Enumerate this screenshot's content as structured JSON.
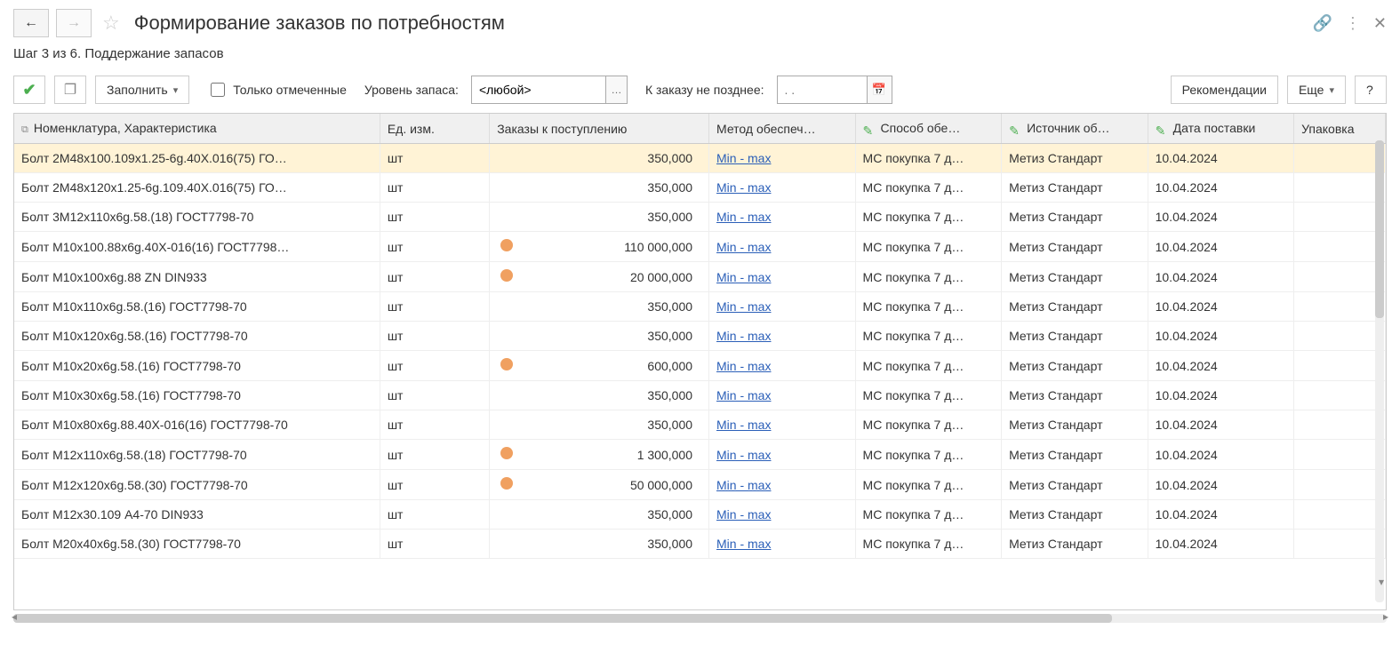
{
  "title": "Формирование заказов по потребностям",
  "breadcrumb": "Шаг 3 из 6. Поддержание запасов",
  "toolbar": {
    "fill_label": "Заполнить",
    "only_checked_label": "Только отмеченные",
    "stock_level_label": "Уровень запаса:",
    "stock_level_value": "<любой>",
    "order_before_label": "К заказу не позднее:",
    "date_placeholder": ". .",
    "recommendations_label": "Рекомендации",
    "more_label": "Еще",
    "help_label": "?"
  },
  "columns": {
    "name": "Номенклатура, Характеристика",
    "unit": "Ед. изм.",
    "orders": "Заказы к поступлению",
    "method": "Метод обеспеч",
    "way": "Способ обе",
    "source": "Источник об",
    "date": "Дата поставки",
    "pack": "Упаковка"
  },
  "method_link_text": "Min - max",
  "rows": [
    {
      "name": "Болт 2М48х100.109х1.25-6g.40Х.016(75) ГО…",
      "unit": "шт",
      "dot": false,
      "orders": "350,000",
      "way": "МС покупка 7 д…",
      "source": "Метиз Стандарт",
      "date": "10.04.2024",
      "selected": true
    },
    {
      "name": "Болт 2М48х120х1.25-6g.109.40Х.016(75) ГО…",
      "unit": "шт",
      "dot": false,
      "orders": "350,000",
      "way": "МС покупка 7 д…",
      "source": "Метиз Стандарт",
      "date": "10.04.2024"
    },
    {
      "name": "Болт 3М12х110х6g.58.(18) ГОСТ7798-70",
      "unit": "шт",
      "dot": false,
      "orders": "350,000",
      "way": "МС покупка 7 д…",
      "source": "Метиз Стандарт",
      "date": "10.04.2024"
    },
    {
      "name": "Болт М10х100.88х6g.40Х-016(16) ГОСТ7798…",
      "unit": "шт",
      "dot": true,
      "orders": "110 000,000",
      "way": "МС покупка 7 д…",
      "source": "Метиз Стандарт",
      "date": "10.04.2024"
    },
    {
      "name": "Болт М10х100х6g.88 ZN DIN933",
      "unit": "шт",
      "dot": true,
      "orders": "20 000,000",
      "way": "МС покупка 7 д…",
      "source": "Метиз Стандарт",
      "date": "10.04.2024"
    },
    {
      "name": "Болт М10х110х6g.58.(16) ГОСТ7798-70",
      "unit": "шт",
      "dot": false,
      "orders": "350,000",
      "way": "МС покупка 7 д…",
      "source": "Метиз Стандарт",
      "date": "10.04.2024"
    },
    {
      "name": "Болт М10х120х6g.58.(16) ГОСТ7798-70",
      "unit": "шт",
      "dot": false,
      "orders": "350,000",
      "way": "МС покупка 7 д…",
      "source": "Метиз Стандарт",
      "date": "10.04.2024"
    },
    {
      "name": "Болт М10х20х6g.58.(16) ГОСТ7798-70",
      "unit": "шт",
      "dot": true,
      "orders": "600,000",
      "way": "МС покупка 7 д…",
      "source": "Метиз Стандарт",
      "date": "10.04.2024"
    },
    {
      "name": "Болт М10х30х6g.58.(16) ГОСТ7798-70",
      "unit": "шт",
      "dot": false,
      "orders": "350,000",
      "way": "МС покупка 7 д…",
      "source": "Метиз Стандарт",
      "date": "10.04.2024"
    },
    {
      "name": "Болт М10х80х6g.88.40Х-016(16) ГОСТ7798-70",
      "unit": "шт",
      "dot": false,
      "orders": "350,000",
      "way": "МС покупка 7 д…",
      "source": "Метиз Стандарт",
      "date": "10.04.2024"
    },
    {
      "name": "Болт М12х110х6g.58.(18) ГОСТ7798-70",
      "unit": "шт",
      "dot": true,
      "orders": "1 300,000",
      "way": "МС покупка 7 д…",
      "source": "Метиз Стандарт",
      "date": "10.04.2024"
    },
    {
      "name": "Болт М12х120х6g.58.(30) ГОСТ7798-70",
      "unit": "шт",
      "dot": true,
      "orders": "50 000,000",
      "way": "МС покупка 7 д…",
      "source": "Метиз Стандарт",
      "date": "10.04.2024"
    },
    {
      "name": "Болт М12х30.109 А4-70 DIN933",
      "unit": "шт",
      "dot": false,
      "orders": "350,000",
      "way": "МС покупка 7 д…",
      "source": "Метиз Стандарт",
      "date": "10.04.2024"
    },
    {
      "name": "Болт М20х40х6g.58.(30) ГОСТ7798-70",
      "unit": "шт",
      "dot": false,
      "orders": "350,000",
      "way": "МС покупка 7 д…",
      "source": "Метиз Стандарт",
      "date": "10.04.2024"
    }
  ]
}
